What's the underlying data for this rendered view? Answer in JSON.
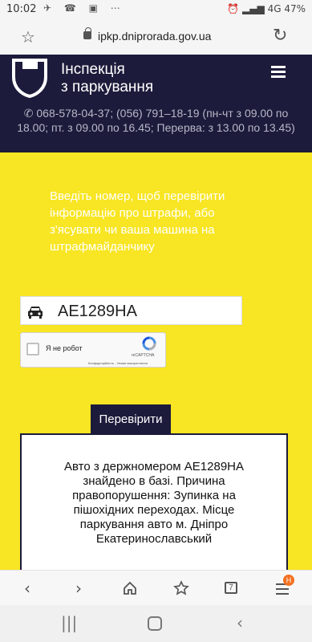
{
  "status_bar": {
    "time": "10:02",
    "battery": "47%",
    "network": "4G"
  },
  "browser": {
    "url": "ipkp.dniprorada.gov.ua"
  },
  "site": {
    "title_line1": "Інспекція",
    "title_line2": "з паркування",
    "contacts": "068-578-04-37; (056) 791–18-19 (пн-чт з 09.00 по 18.00; пт. з 09.00 по 16.45; Перерва: з 13.00 по 13.45)"
  },
  "main": {
    "intro": "Введіть номер, щоб перевірити інформацію про штрафи, або з'ясувати чи ваша машина на штрафмайданчику",
    "plate_value": "AE1289HA",
    "captcha_label": "Я не робот",
    "captcha_brand": "reCAPTCHA",
    "captcha_links": "Конфіденційність - Умови використання",
    "check_button": "Перевірити",
    "result_text": "Авто з держномером AE1289HA знайдено в базі. Причина правопорушення: Зупинка на пішохідних переходах. Місце паркування авто м. Дніпро Екатеринославський"
  },
  "bottom_bar": {
    "tabs_count": "7",
    "menu_badge": "H"
  },
  "colors": {
    "header_bg": "#1c1b3b",
    "accent_yellow": "#f8e523",
    "badge_orange": "#f37021"
  }
}
